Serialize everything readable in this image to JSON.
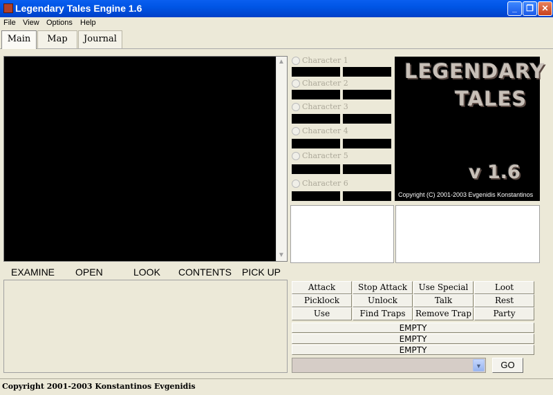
{
  "window": {
    "title": "Legendary Tales Engine 1.6",
    "minimize": "_",
    "maximize": "❐",
    "close": "✕"
  },
  "menu": [
    "File",
    "View",
    "Options",
    "Help"
  ],
  "tabs": [
    "Main",
    "Map",
    "Journal"
  ],
  "scrollbar": {
    "up": "▲",
    "down": "▼"
  },
  "characters": [
    "Character 1",
    "Character 2",
    "Character 3",
    "Character 4",
    "Character 5",
    "Character 6"
  ],
  "logo": {
    "line1": "LEGENDARY",
    "line2": "TALES",
    "version": "v 1.6",
    "copyright": "Copyright (C) 2001-2003 Evgenidis Konstantinos"
  },
  "actions": [
    "EXAMINE",
    "OPEN",
    "LOOK",
    "CONTENTS",
    "PICK UP"
  ],
  "commands": [
    "Attack",
    "Stop Attack",
    "Use Special",
    "Loot",
    "Picklock",
    "Unlock",
    "Talk",
    "Rest",
    "Use",
    "Find Traps",
    "Remove Trap",
    "Party"
  ],
  "slots": [
    "EMPTY",
    "EMPTY",
    "EMPTY"
  ],
  "combo": {
    "arrow": "▼",
    "go": "GO"
  },
  "status": "Copyright 2001-2003 Konstantinos Evgenidis",
  "colors": {
    "titlebar": "#0055e5",
    "window_bg": "#ece9d8"
  }
}
